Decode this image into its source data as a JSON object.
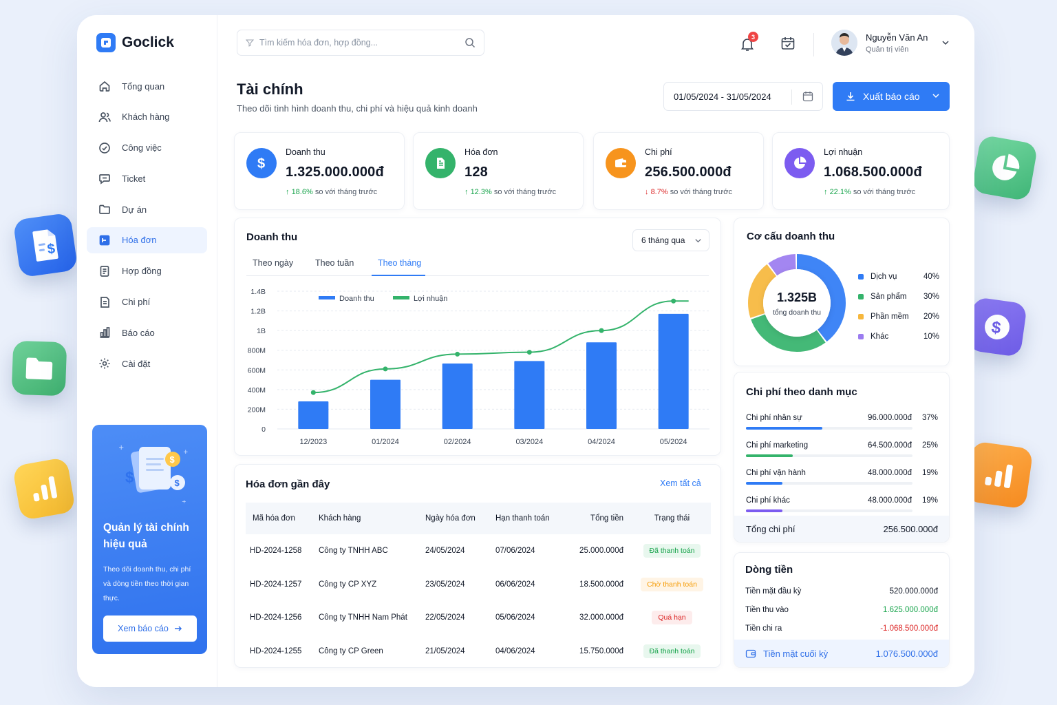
{
  "brand": {
    "name": "Goclick"
  },
  "sidebar": {
    "items": [
      {
        "label": "Tổng quan",
        "icon": "home-icon"
      },
      {
        "label": "Khách hàng",
        "icon": "users-icon"
      },
      {
        "label": "Công việc",
        "icon": "task-icon"
      },
      {
        "label": "Ticket",
        "icon": "ticket-icon"
      },
      {
        "label": "Dự án",
        "icon": "folder-icon"
      },
      {
        "label": "Hóa đơn",
        "icon": "invoice-icon",
        "active": true
      },
      {
        "label": "Hợp đồng",
        "icon": "contract-icon"
      },
      {
        "label": "Chi phí",
        "icon": "expense-icon"
      },
      {
        "label": "Báo cáo",
        "icon": "report-icon"
      },
      {
        "label": "Cài đặt",
        "icon": "settings-icon"
      }
    ],
    "promo": {
      "title": "Quản lý tài chính hiệu quả",
      "text": "Theo dõi doanh thu, chi phí và dòng tiền theo thời gian thực.",
      "button": "Xem báo cáo"
    }
  },
  "header": {
    "search_placeholder": "Tìm kiếm hóa đơn, hợp đồng...",
    "notifications": "3",
    "user": {
      "name": "Nguyễn Văn An",
      "role": "Quản trị viên"
    }
  },
  "page": {
    "title": "Tài chính",
    "subtitle": "Theo dõi tình hình doanh thu, chi phí và hiệu quả kinh doanh",
    "date_range": "01/05/2024 - 31/05/2024",
    "export_label": "Xuất báo cáo"
  },
  "stats": [
    {
      "label": "Doanh thu",
      "value": "1.325.000.000đ",
      "delta": "18.6%",
      "direction": "up",
      "note": "so với tháng trước",
      "color": "#2f7bf5"
    },
    {
      "label": "Hóa đơn",
      "value": "128",
      "delta": "12.3%",
      "direction": "up",
      "note": "so với tháng trước",
      "color": "#34b36b"
    },
    {
      "label": "Chi phí",
      "value": "256.500.000đ",
      "delta": "8.7%",
      "direction": "down",
      "note": "so với tháng trước",
      "color": "#f7941d"
    },
    {
      "label": "Lợi nhuận",
      "value": "1.068.500.000đ",
      "delta": "22.1%",
      "direction": "up",
      "note": "so với tháng trước",
      "color": "#7c5cf0"
    }
  ],
  "revenue_chart": {
    "title": "Doanh thu",
    "tabs": [
      "Theo ngày",
      "Theo tuần",
      "Theo tháng"
    ],
    "active_tab": 2,
    "range": "6 tháng qua"
  },
  "chart_data": {
    "type": "bar",
    "categories": [
      "12/2023",
      "01/2024",
      "02/2024",
      "03/2024",
      "04/2024",
      "05/2024"
    ],
    "series": [
      {
        "name": "Doanh thu",
        "type": "bar",
        "color": "#2f7bf5",
        "values": [
          280,
          500,
          665,
          690,
          880,
          1170
        ]
      },
      {
        "name": "Lợi nhuận",
        "type": "line",
        "color": "#34b36b",
        "values": [
          370,
          610,
          760,
          780,
          1000,
          1300
        ]
      }
    ],
    "y_ticks": [
      "0",
      "200M",
      "400M",
      "600M",
      "800M",
      "1B",
      "1.2B",
      "1.4B"
    ],
    "ylim": [
      0,
      1400
    ],
    "unit": "M",
    "legend": "top-left",
    "grid": "horizontal dashed"
  },
  "structure": {
    "title": "Cơ cấu doanh thu",
    "center_value": "1.325B",
    "center_label": "tổng doanh thu",
    "items": [
      {
        "name": "Dịch vụ",
        "pct": "40%",
        "value": 40,
        "color": "#2f7bf5"
      },
      {
        "name": "Sản phẩm",
        "pct": "30%",
        "value": 30,
        "color": "#34b36b"
      },
      {
        "name": "Phần mềm",
        "pct": "20%",
        "value": 20,
        "color": "#f6b73c"
      },
      {
        "name": "Khác",
        "pct": "10%",
        "value": 10,
        "color": "#9b7cf0"
      }
    ]
  },
  "expenses": {
    "title": "Chi phí theo danh mục",
    "items": [
      {
        "label": "Chi phí nhân sự",
        "amount": "96.000.000đ",
        "pct": "37%",
        "fraction": 0.46,
        "color": "#2f7bf5"
      },
      {
        "label": "Chi phí marketing",
        "amount": "64.500.000đ",
        "pct": "25%",
        "fraction": 0.28,
        "color": "#34b36b"
      },
      {
        "label": "Chi phí vận hành",
        "amount": "48.000.000đ",
        "pct": "19%",
        "fraction": 0.22,
        "color": "#2f7bf5"
      },
      {
        "label": "Chi phí khác",
        "amount": "48.000.000đ",
        "pct": "19%",
        "fraction": 0.22,
        "color": "#7c5cf0"
      }
    ],
    "total_label": "Tổng chi phí",
    "total_value": "256.500.000đ"
  },
  "cashflow": {
    "title": "Dòng tiền",
    "rows": [
      {
        "label": "Tiền mặt đầu kỳ",
        "value": "520.000.000đ",
        "tone": "neutral"
      },
      {
        "label": "Tiền thu vào",
        "value": "1.625.000.000đ",
        "tone": "up"
      },
      {
        "label": "Tiền chi ra",
        "value": "-1.068.500.000đ",
        "tone": "down"
      }
    ],
    "end_label": "Tiền mặt cuối kỳ",
    "end_value": "1.076.500.000đ"
  },
  "invoices": {
    "title": "Hóa đơn gần đây",
    "view_all": "Xem tất cả",
    "columns": [
      "Mã hóa đơn",
      "Khách hàng",
      "Ngày hóa đơn",
      "Hạn thanh toán",
      "Tổng tiền",
      "Trạng thái"
    ],
    "rows": [
      {
        "id": "HD-2024-1258",
        "customer": "Công ty TNHH ABC",
        "date": "24/05/2024",
        "due": "07/06/2024",
        "total": "25.000.000đ",
        "status": "Đã thanh toán",
        "status_type": "paid"
      },
      {
        "id": "HD-2024-1257",
        "customer": "Công ty CP XYZ",
        "date": "23/05/2024",
        "due": "06/06/2024",
        "total": "18.500.000đ",
        "status": "Chờ thanh toán",
        "status_type": "wait"
      },
      {
        "id": "HD-2024-1256",
        "customer": "Công ty TNHH Nam Phát",
        "date": "22/05/2024",
        "due": "05/06/2024",
        "total": "32.000.000đ",
        "status": "Quá hạn",
        "status_type": "over"
      },
      {
        "id": "HD-2024-1255",
        "customer": "Công ty CP Green",
        "date": "21/05/2024",
        "due": "04/06/2024",
        "total": "15.750.000đ",
        "status": "Đã thanh toán",
        "status_type": "paid"
      }
    ]
  }
}
